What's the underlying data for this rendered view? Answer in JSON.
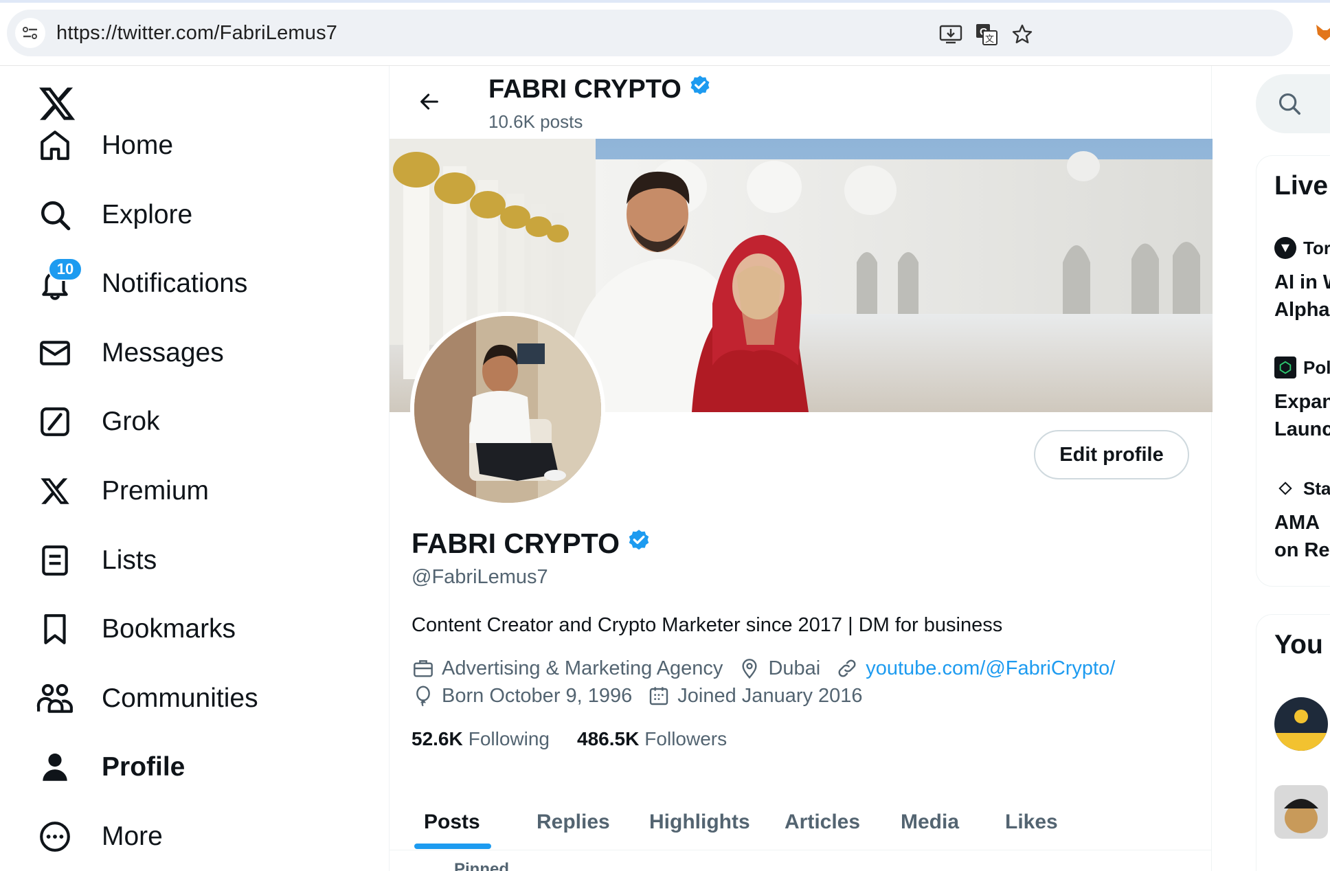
{
  "browser": {
    "url": "https://twitter.com/FabriLemus7",
    "icons": [
      "site-info-icon",
      "install-app-icon",
      "translate-icon",
      "bookmark-star-icon",
      "extension-fox-icon"
    ]
  },
  "nav": {
    "logo": "x-logo",
    "items": [
      {
        "label": "Home",
        "icon": "home-icon"
      },
      {
        "label": "Explore",
        "icon": "search-icon"
      },
      {
        "label": "Notifications",
        "icon": "bell-icon",
        "badge": "10"
      },
      {
        "label": "Messages",
        "icon": "envelope-icon"
      },
      {
        "label": "Grok",
        "icon": "grok-icon"
      },
      {
        "label": "Premium",
        "icon": "x-icon"
      },
      {
        "label": "Lists",
        "icon": "list-icon"
      },
      {
        "label": "Bookmarks",
        "icon": "bookmark-icon"
      },
      {
        "label": "Communities",
        "icon": "communities-icon"
      },
      {
        "label": "Profile",
        "icon": "person-icon"
      },
      {
        "label": "More",
        "icon": "more-icon"
      }
    ]
  },
  "profile": {
    "name": "FABRI CRYPTO",
    "posts_count": "10.6K posts",
    "handle": "@FabriLemus7",
    "bio": "Content Creator and Crypto Marketer since 2017 | DM for business",
    "category": "Advertising & Marketing Agency",
    "location": "Dubai",
    "website": "youtube.com/@FabriCrypto/",
    "birthday": "Born October 9, 1996",
    "joined": "Joined January 2016",
    "following_count": "52.6K",
    "following_label": "Following",
    "followers_count": "486.5K",
    "followers_label": "Followers",
    "edit_label": "Edit profile",
    "verified": true
  },
  "tabs": [
    {
      "label": "Posts",
      "active": true
    },
    {
      "label": "Replies",
      "active": false
    },
    {
      "label": "Highlights",
      "active": false
    },
    {
      "label": "Articles",
      "active": false
    },
    {
      "label": "Media",
      "active": false
    },
    {
      "label": "Likes",
      "active": false
    }
  ],
  "pinned_label": "Pinned",
  "right_panel": {
    "live_title": "Live",
    "live_items": [
      {
        "source": "Tor",
        "text_line1": "AI in W",
        "text_line2": "Alpha"
      },
      {
        "source": "Pol",
        "text_line1": "Expan",
        "text_line2": "Launc"
      },
      {
        "source": "Sta",
        "text_line1": "AMA",
        "text_line2": "on Re"
      }
    ],
    "who_title": "You"
  },
  "colors": {
    "accent": "#1d9bf0",
    "text_primary": "#0f1419",
    "text_secondary": "#536471"
  }
}
